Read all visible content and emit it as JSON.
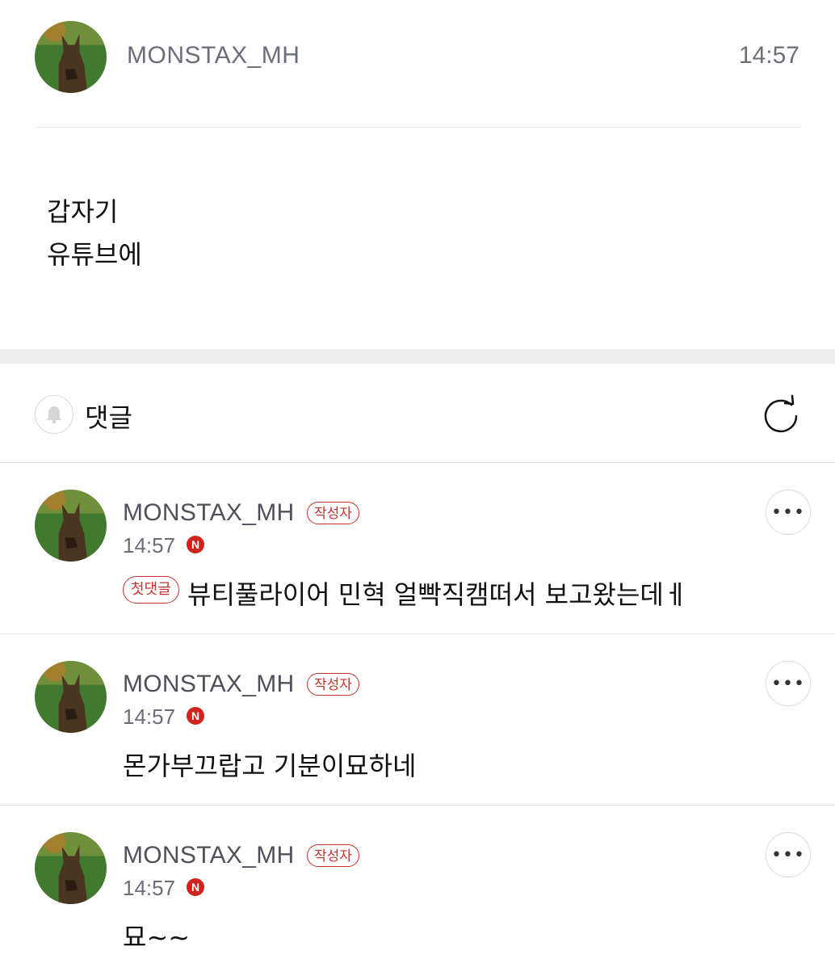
{
  "post": {
    "author": "MONSTAX_MH",
    "time": "14:57",
    "lines": [
      "갑자기",
      "유튜브에"
    ]
  },
  "comments_section": {
    "title": "댓글",
    "icons": {
      "bell": "bell-icon",
      "refresh": "refresh-icon"
    }
  },
  "comments": [
    {
      "author": "MONSTAX_MH",
      "author_badge": "작성자",
      "time": "14:57",
      "new_badge": "N",
      "first_badge": "첫댓글",
      "text": "뷰티풀라이어 민혁 얼빡직캠떠서 보고왔는데ㅔ",
      "more": "•••"
    },
    {
      "author": "MONSTAX_MH",
      "author_badge": "작성자",
      "time": "14:57",
      "new_badge": "N",
      "text": "몬가부끄랍고 기분이묘하네",
      "more": "•••"
    },
    {
      "author": "MONSTAX_MH",
      "author_badge": "작성자",
      "time": "14:57",
      "new_badge": "N",
      "text": "묘~~",
      "more": "•••"
    }
  ],
  "colors": {
    "accent": "#c6342e",
    "meta": "#6b6d79"
  }
}
